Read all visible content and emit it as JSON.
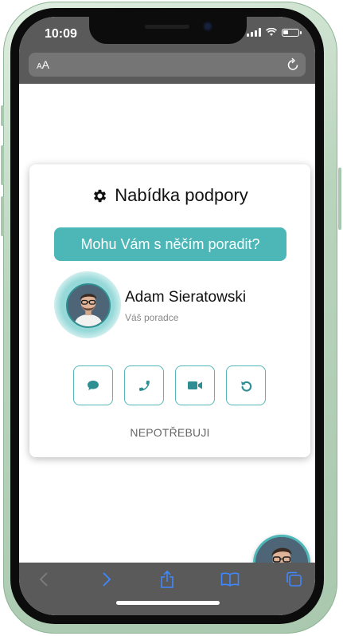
{
  "status": {
    "time": "10:09"
  },
  "browser": {
    "text_size_label": "AA"
  },
  "widget": {
    "title": "Nabídka podpory",
    "cta_label": "Mohu Vám s něčím poradit?",
    "agent": {
      "name": "Adam Sieratowski",
      "role": "Váš poradce"
    },
    "actions": [
      {
        "icon": "chat-icon"
      },
      {
        "icon": "phone-icon"
      },
      {
        "icon": "video-icon"
      },
      {
        "icon": "callback-icon"
      }
    ],
    "decline_label": "NEPOTŘEBUJI"
  },
  "colors": {
    "accent": "#4db6b6",
    "accent_dark": "#2f8e92",
    "browser_bar": "#5a5a5a",
    "nav_icon": "#3f88ff"
  }
}
